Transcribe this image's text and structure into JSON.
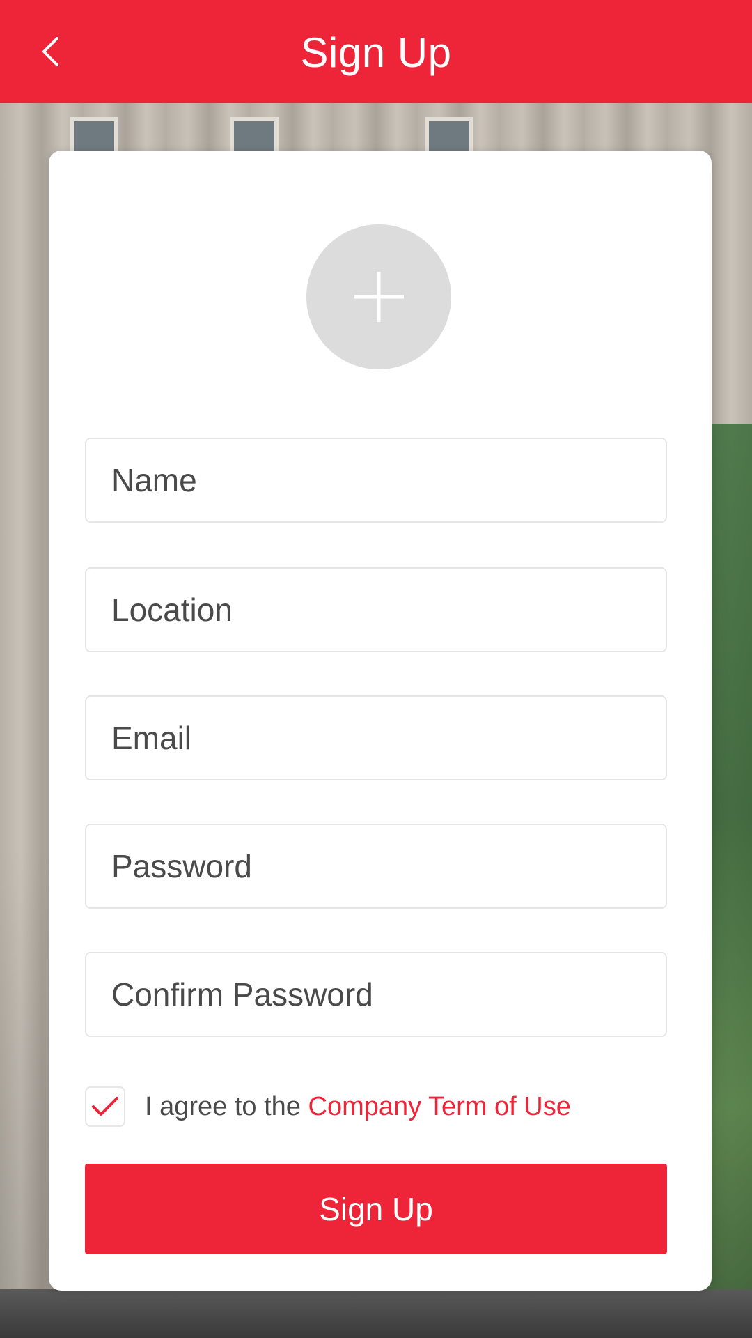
{
  "colors": {
    "brand": "#ee2438",
    "card": "#ffffff",
    "avatar_bg": "#dcdcdc",
    "field_text": "#4a4a4a"
  },
  "app_bar": {
    "title": "Sign Up",
    "back_icon": "chevron-left-icon"
  },
  "avatar": {
    "icon": "plus-icon"
  },
  "form": {
    "fields": [
      {
        "placeholder": "Name"
      },
      {
        "placeholder": "Location"
      },
      {
        "placeholder": "Email"
      },
      {
        "placeholder": "Password"
      },
      {
        "placeholder": "Confirm Password"
      }
    ],
    "terms": {
      "checked": true,
      "check_icon": "checkmark-icon",
      "prefix": "I agree to the ",
      "link": "Company Term of Use"
    },
    "submit_label": "Sign Up"
  }
}
